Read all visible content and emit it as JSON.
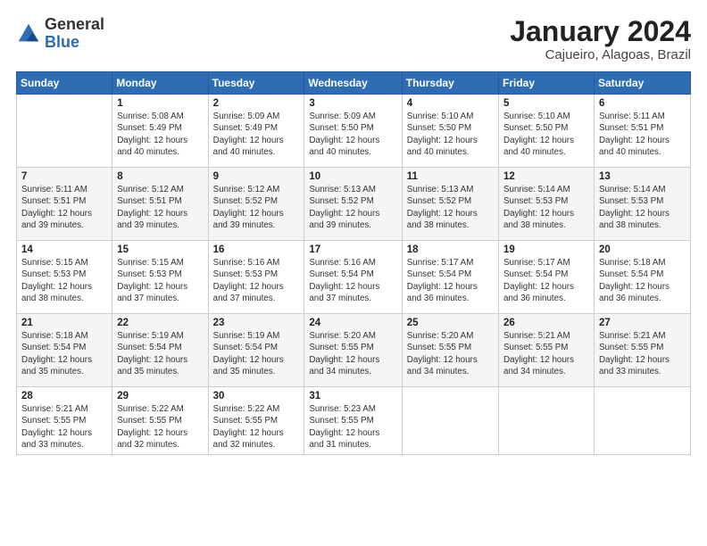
{
  "header": {
    "logo_line1": "General",
    "logo_line2": "Blue",
    "month": "January 2024",
    "location": "Cajueiro, Alagoas, Brazil"
  },
  "weekdays": [
    "Sunday",
    "Monday",
    "Tuesday",
    "Wednesday",
    "Thursday",
    "Friday",
    "Saturday"
  ],
  "weeks": [
    [
      {
        "day": "",
        "info": ""
      },
      {
        "day": "1",
        "info": "Sunrise: 5:08 AM\nSunset: 5:49 PM\nDaylight: 12 hours\nand 40 minutes."
      },
      {
        "day": "2",
        "info": "Sunrise: 5:09 AM\nSunset: 5:49 PM\nDaylight: 12 hours\nand 40 minutes."
      },
      {
        "day": "3",
        "info": "Sunrise: 5:09 AM\nSunset: 5:50 PM\nDaylight: 12 hours\nand 40 minutes."
      },
      {
        "day": "4",
        "info": "Sunrise: 5:10 AM\nSunset: 5:50 PM\nDaylight: 12 hours\nand 40 minutes."
      },
      {
        "day": "5",
        "info": "Sunrise: 5:10 AM\nSunset: 5:50 PM\nDaylight: 12 hours\nand 40 minutes."
      },
      {
        "day": "6",
        "info": "Sunrise: 5:11 AM\nSunset: 5:51 PM\nDaylight: 12 hours\nand 40 minutes."
      }
    ],
    [
      {
        "day": "7",
        "info": "Sunrise: 5:11 AM\nSunset: 5:51 PM\nDaylight: 12 hours\nand 39 minutes."
      },
      {
        "day": "8",
        "info": "Sunrise: 5:12 AM\nSunset: 5:51 PM\nDaylight: 12 hours\nand 39 minutes."
      },
      {
        "day": "9",
        "info": "Sunrise: 5:12 AM\nSunset: 5:52 PM\nDaylight: 12 hours\nand 39 minutes."
      },
      {
        "day": "10",
        "info": "Sunrise: 5:13 AM\nSunset: 5:52 PM\nDaylight: 12 hours\nand 39 minutes."
      },
      {
        "day": "11",
        "info": "Sunrise: 5:13 AM\nSunset: 5:52 PM\nDaylight: 12 hours\nand 38 minutes."
      },
      {
        "day": "12",
        "info": "Sunrise: 5:14 AM\nSunset: 5:53 PM\nDaylight: 12 hours\nand 38 minutes."
      },
      {
        "day": "13",
        "info": "Sunrise: 5:14 AM\nSunset: 5:53 PM\nDaylight: 12 hours\nand 38 minutes."
      }
    ],
    [
      {
        "day": "14",
        "info": "Sunrise: 5:15 AM\nSunset: 5:53 PM\nDaylight: 12 hours\nand 38 minutes."
      },
      {
        "day": "15",
        "info": "Sunrise: 5:15 AM\nSunset: 5:53 PM\nDaylight: 12 hours\nand 37 minutes."
      },
      {
        "day": "16",
        "info": "Sunrise: 5:16 AM\nSunset: 5:53 PM\nDaylight: 12 hours\nand 37 minutes."
      },
      {
        "day": "17",
        "info": "Sunrise: 5:16 AM\nSunset: 5:54 PM\nDaylight: 12 hours\nand 37 minutes."
      },
      {
        "day": "18",
        "info": "Sunrise: 5:17 AM\nSunset: 5:54 PM\nDaylight: 12 hours\nand 36 minutes."
      },
      {
        "day": "19",
        "info": "Sunrise: 5:17 AM\nSunset: 5:54 PM\nDaylight: 12 hours\nand 36 minutes."
      },
      {
        "day": "20",
        "info": "Sunrise: 5:18 AM\nSunset: 5:54 PM\nDaylight: 12 hours\nand 36 minutes."
      }
    ],
    [
      {
        "day": "21",
        "info": "Sunrise: 5:18 AM\nSunset: 5:54 PM\nDaylight: 12 hours\nand 35 minutes."
      },
      {
        "day": "22",
        "info": "Sunrise: 5:19 AM\nSunset: 5:54 PM\nDaylight: 12 hours\nand 35 minutes."
      },
      {
        "day": "23",
        "info": "Sunrise: 5:19 AM\nSunset: 5:54 PM\nDaylight: 12 hours\nand 35 minutes."
      },
      {
        "day": "24",
        "info": "Sunrise: 5:20 AM\nSunset: 5:55 PM\nDaylight: 12 hours\nand 34 minutes."
      },
      {
        "day": "25",
        "info": "Sunrise: 5:20 AM\nSunset: 5:55 PM\nDaylight: 12 hours\nand 34 minutes."
      },
      {
        "day": "26",
        "info": "Sunrise: 5:21 AM\nSunset: 5:55 PM\nDaylight: 12 hours\nand 34 minutes."
      },
      {
        "day": "27",
        "info": "Sunrise: 5:21 AM\nSunset: 5:55 PM\nDaylight: 12 hours\nand 33 minutes."
      }
    ],
    [
      {
        "day": "28",
        "info": "Sunrise: 5:21 AM\nSunset: 5:55 PM\nDaylight: 12 hours\nand 33 minutes."
      },
      {
        "day": "29",
        "info": "Sunrise: 5:22 AM\nSunset: 5:55 PM\nDaylight: 12 hours\nand 32 minutes."
      },
      {
        "day": "30",
        "info": "Sunrise: 5:22 AM\nSunset: 5:55 PM\nDaylight: 12 hours\nand 32 minutes."
      },
      {
        "day": "31",
        "info": "Sunrise: 5:23 AM\nSunset: 5:55 PM\nDaylight: 12 hours\nand 31 minutes."
      },
      {
        "day": "",
        "info": ""
      },
      {
        "day": "",
        "info": ""
      },
      {
        "day": "",
        "info": ""
      }
    ]
  ]
}
